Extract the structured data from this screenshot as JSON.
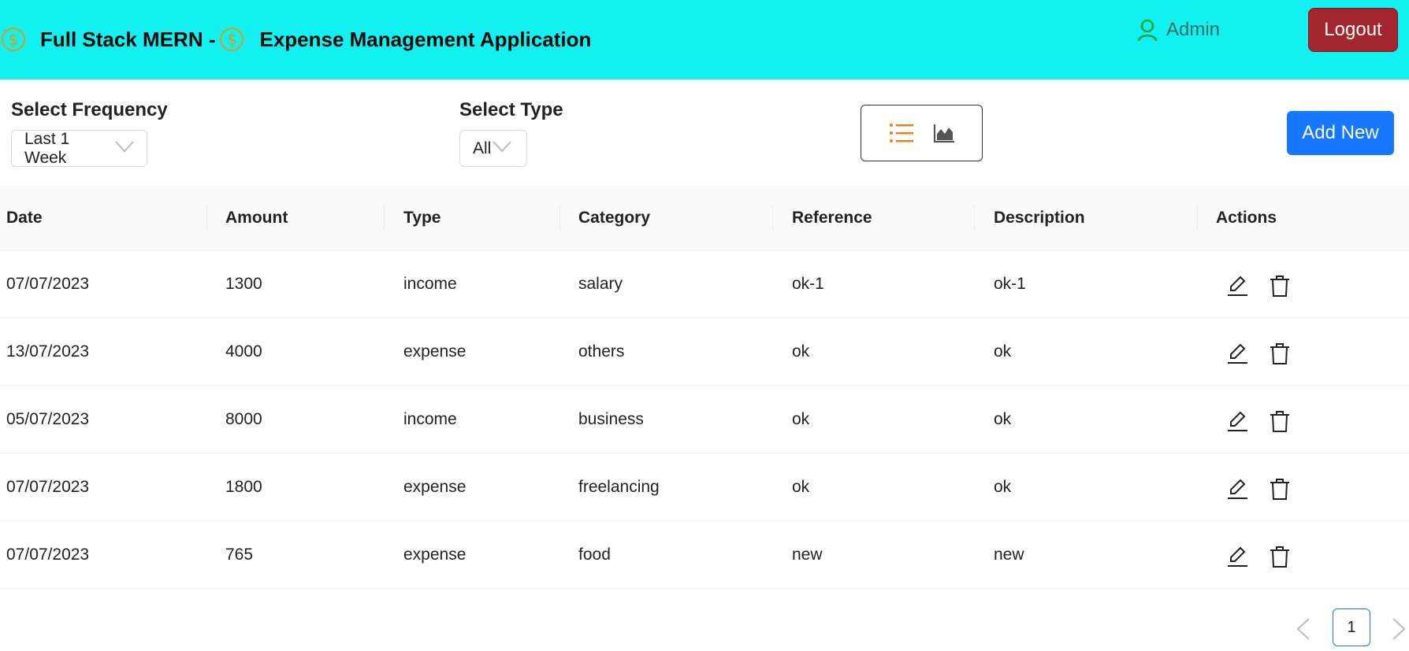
{
  "header": {
    "title_part1": "Full Stack MERN -",
    "title_part2": "Expense Management Application",
    "brand_icon": "dollar-coin-icon",
    "user_name": "Admin",
    "logout_label": "Logout",
    "bg_color": "#12f0f0"
  },
  "filters": {
    "frequency_label": "Select Frequency",
    "frequency_value": "Last 1 Week",
    "type_label": "Select Type",
    "type_value": "All"
  },
  "view_toggle": {
    "active": "list",
    "list_icon": "unordered-list-icon",
    "chart_icon": "area-chart-icon"
  },
  "add_new_label": "Add New",
  "table": {
    "columns": [
      "Date",
      "Amount",
      "Type",
      "Category",
      "Reference",
      "Description",
      "Actions"
    ],
    "rows": [
      {
        "date": "07/07/2023",
        "amount": "1300",
        "type": "income",
        "category": "salary",
        "reference": "ok-1",
        "description": "ok-1"
      },
      {
        "date": "13/07/2023",
        "amount": "4000",
        "type": "expense",
        "category": "others",
        "reference": "ok",
        "description": "ok"
      },
      {
        "date": "05/07/2023",
        "amount": "8000",
        "type": "income",
        "category": "business",
        "reference": "ok",
        "description": "ok"
      },
      {
        "date": "07/07/2023",
        "amount": "1800",
        "type": "expense",
        "category": "freelancing",
        "reference": "ok",
        "description": "ok"
      },
      {
        "date": "07/07/2023",
        "amount": "765",
        "type": "expense",
        "category": "food",
        "reference": "new",
        "description": "new"
      }
    ]
  },
  "pagination": {
    "current_page": "1",
    "prev_icon": "chevron-left-icon",
    "next_icon": "chevron-right-icon"
  },
  "colors": {
    "primary": "#1677ff",
    "danger": "#a3262f",
    "active_icon": "#f07c10"
  }
}
